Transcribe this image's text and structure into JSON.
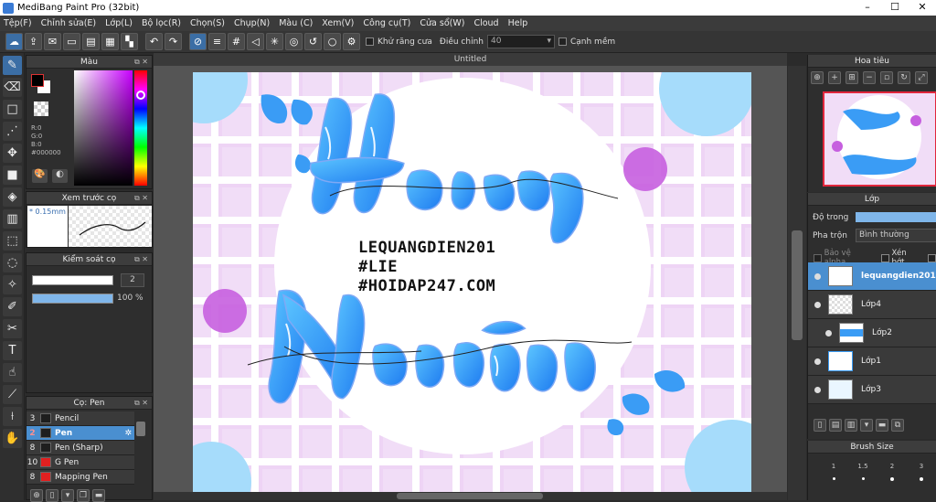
{
  "app": {
    "title": "MediBang Paint Pro (32bit)"
  },
  "menu": [
    "Tệp(F)",
    "Chỉnh sửa(E)",
    "Lớp(L)",
    "Bộ lọc(R)",
    "Chọn(S)",
    "Chụp(N)",
    "Màu (C)",
    "Xem(V)",
    "Công cụ(T)",
    "Cửa sổ(W)",
    "Cloud",
    "Help"
  ],
  "toolbar": {
    "antialias_label": "Khử răng cưa",
    "adjust_label": "Điều chỉnh",
    "adjust_value": "40",
    "edge_label": "Cạnh mềm"
  },
  "color_panel": {
    "title": "Màu",
    "r": "R:0",
    "g": "G:0",
    "b": "B:0",
    "hex": "#000000",
    "fg": "#000000",
    "bg": "#ffffff"
  },
  "preview_panel": {
    "title": "Xem trước cọ",
    "size": "0.15mm"
  },
  "control_panel": {
    "title": "Kiểm soát cọ",
    "size_value": "2",
    "opacity_value": "100 %"
  },
  "brush_panel": {
    "title": "Cọ: Pen",
    "items": [
      {
        "num": "3",
        "name": "Pencil",
        "color": "#1e1e1e"
      },
      {
        "num": "2",
        "name": "Pen",
        "color": "#1e1e1e",
        "selected": true
      },
      {
        "num": "8",
        "name": "Pen (Sharp)",
        "color": "#1e1e1e"
      },
      {
        "num": "10",
        "name": "G Pen",
        "color": "#e02020"
      },
      {
        "num": "8",
        "name": "Mapping Pen",
        "color": "#e02020"
      }
    ]
  },
  "document": {
    "tab": "Untitled"
  },
  "artwork": {
    "line1": "LEQUANGDIEN201",
    "line2": "#LIE",
    "line3": "#HOIDAP247.COM"
  },
  "navigator": {
    "title": "Hoa tiêu"
  },
  "layer_panel": {
    "title": "Lớp",
    "opacity_label": "Độ trong",
    "blend_label": "Pha trộn",
    "blend_value": "Bình thường",
    "protect_alpha": "Bảo vệ alpha",
    "clip": "Xén bớt",
    "layers": [
      {
        "name": "lequangdien201",
        "selected": true
      },
      {
        "name": "Lớp4"
      },
      {
        "name": "Lớp2"
      },
      {
        "name": "Lớp1"
      },
      {
        "name": "Lớp3"
      }
    ]
  },
  "brush_size": {
    "title": "Brush Size",
    "sizes": [
      "1",
      "1.5",
      "2",
      "3"
    ]
  }
}
